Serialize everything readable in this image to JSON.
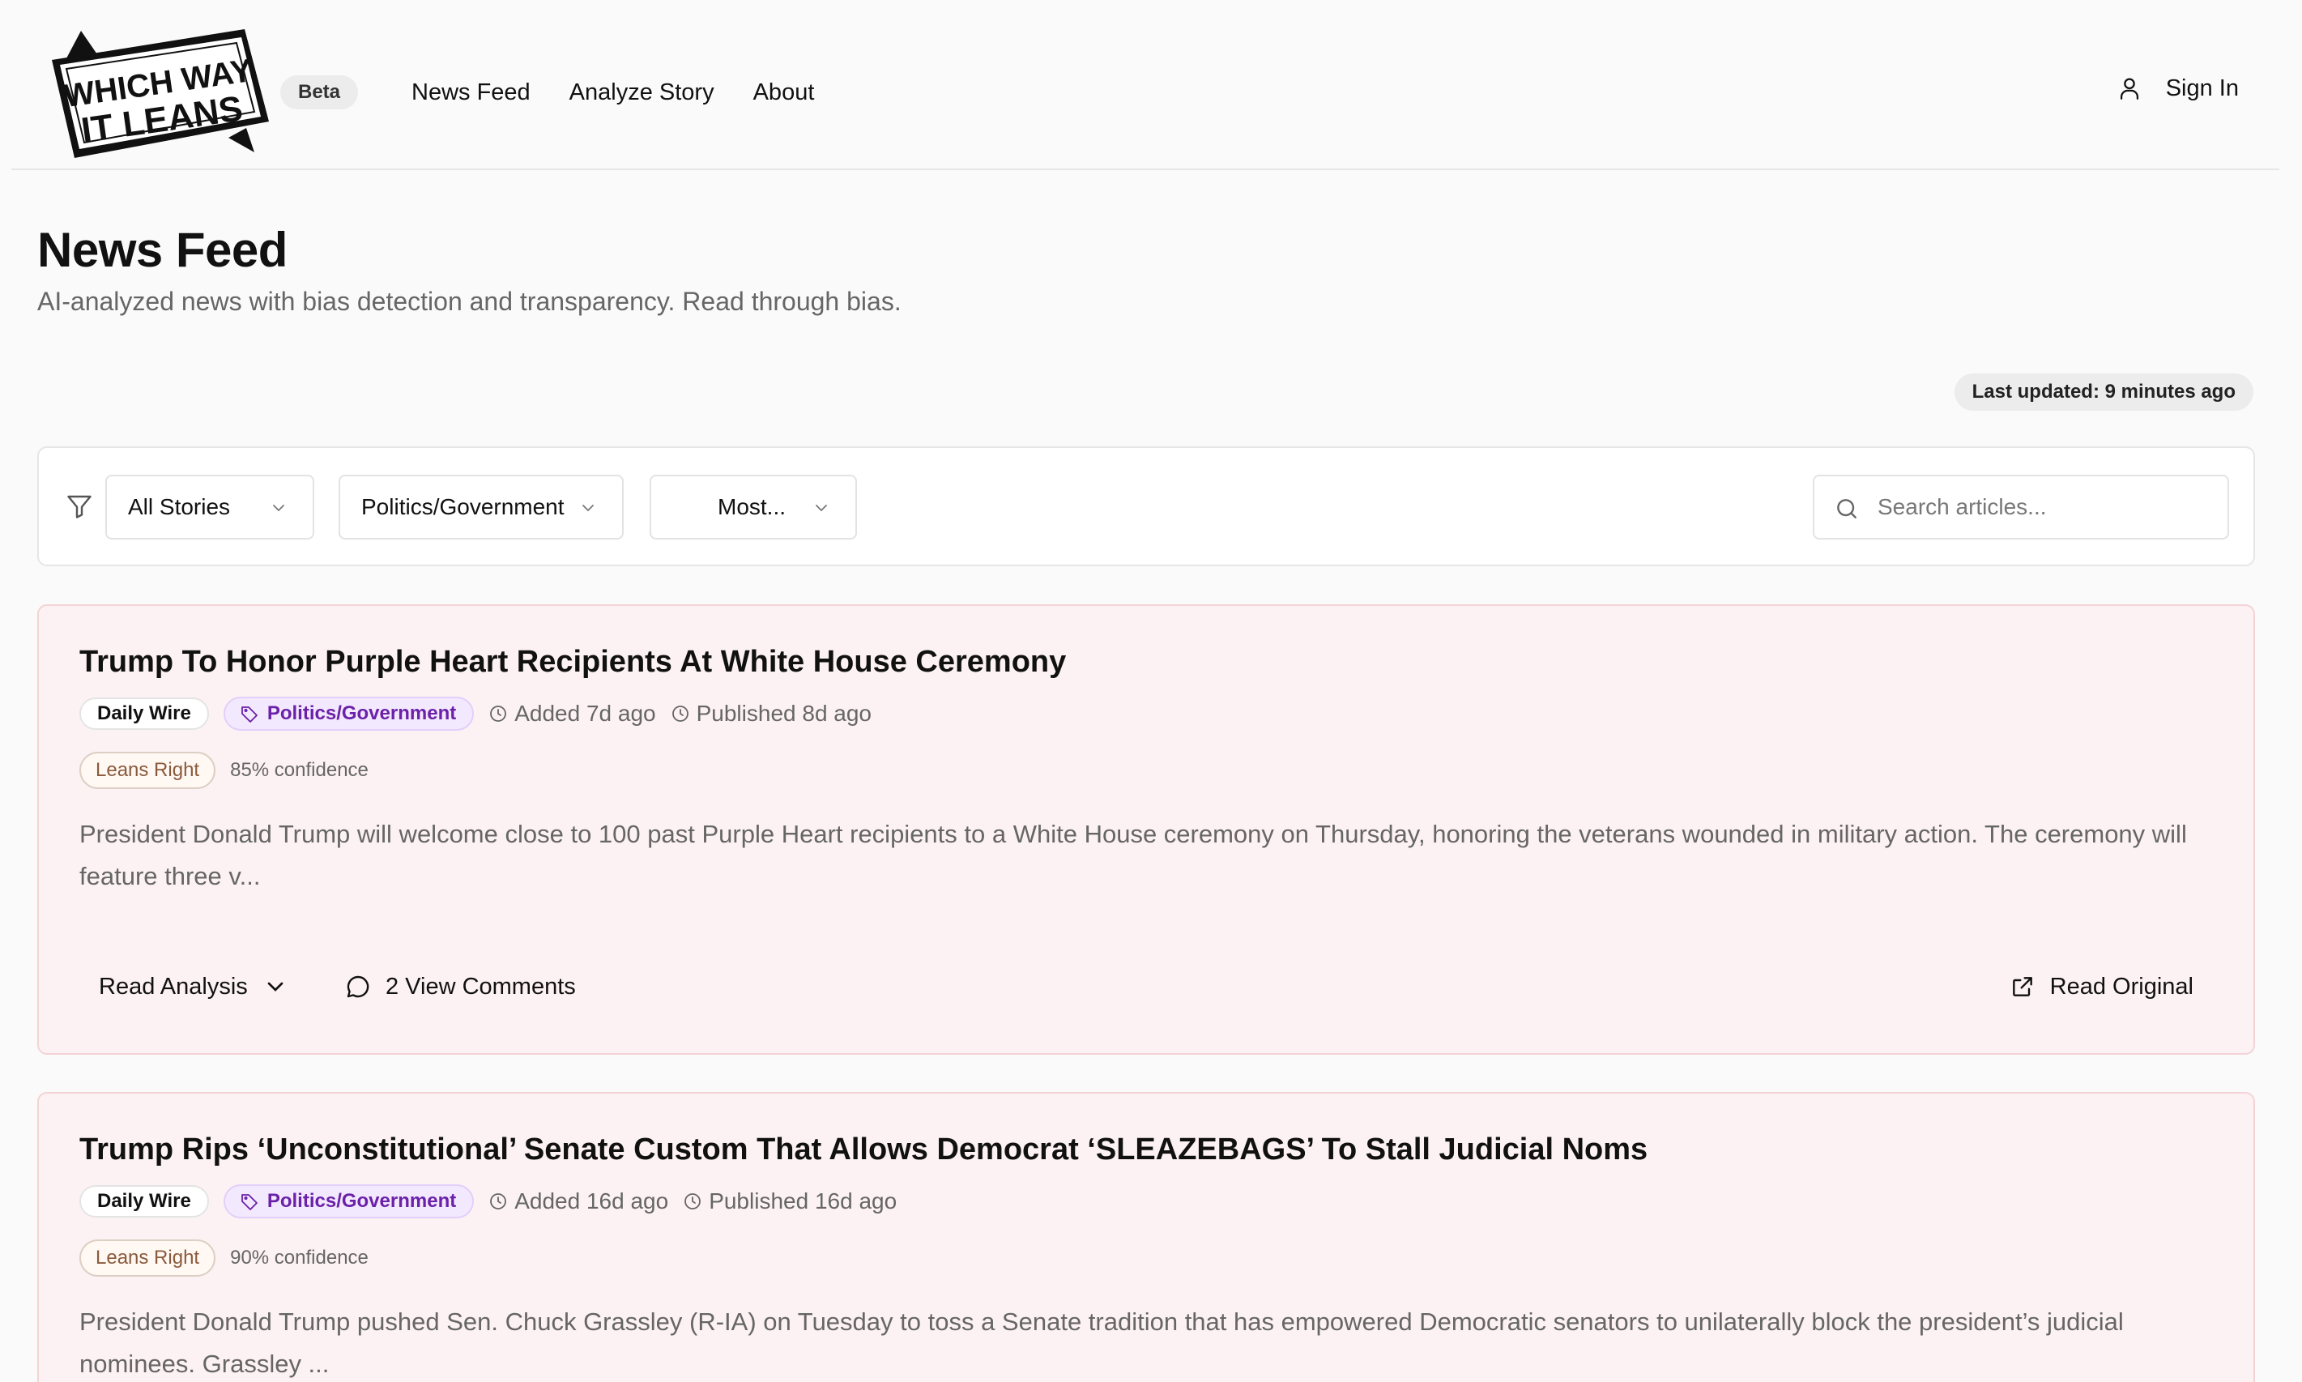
{
  "header": {
    "logo_line1": "WHICH WAY",
    "logo_line2": "IT LEANS",
    "beta": "Beta",
    "nav": [
      "News Feed",
      "Analyze Story",
      "About"
    ],
    "sign_in": "Sign In",
    "icons": {
      "user": "user-icon"
    }
  },
  "page": {
    "title": "News Feed",
    "subtitle": "AI-analyzed news with bias detection and transparency. Read through bias.",
    "last_updated": "Last updated: 9 minutes ago"
  },
  "filters": {
    "story_filter": "All Stories",
    "category_filter": "Politics/Government",
    "sort_filter": "Most...",
    "search_placeholder": "Search articles..."
  },
  "articles": [
    {
      "title": "Trump To Honor Purple Heart Recipients At White House Ceremony",
      "source": "Daily Wire",
      "category": "Politics/Government",
      "added": "Added 7d ago",
      "published": "Published 8d ago",
      "bias": "Leans Right",
      "confidence": "85% confidence",
      "summary": "President Donald Trump will welcome close to 100 past Purple Heart recipients to a White House ceremony on Thursday, honoring the veterans wounded in military action. The ceremony will feature three v...",
      "read_analysis": "Read Analysis",
      "comments": "2 View Comments",
      "read_original": "Read Original"
    },
    {
      "title": "Trump Rips ‘Unconstitutional’ Senate Custom That Allows Democrat ‘SLEAZEBAGS’ To Stall Judicial Noms",
      "source": "Daily Wire",
      "category": "Politics/Government",
      "added": "Added 16d ago",
      "published": "Published 16d ago",
      "bias": "Leans Right",
      "confidence": "90% confidence",
      "summary": "President Donald Trump pushed Sen. Chuck Grassley (R-IA) on Tuesday to toss a Senate tradition that has empowered Democratic senators to unilaterally block the president’s judicial nominees. Grassley ..."
    }
  ],
  "colors": {
    "card_bg": "#fdf2f3",
    "card_border": "#f3d3d6",
    "category_text": "#6b21a8",
    "bias_text": "#8a5a3c"
  }
}
